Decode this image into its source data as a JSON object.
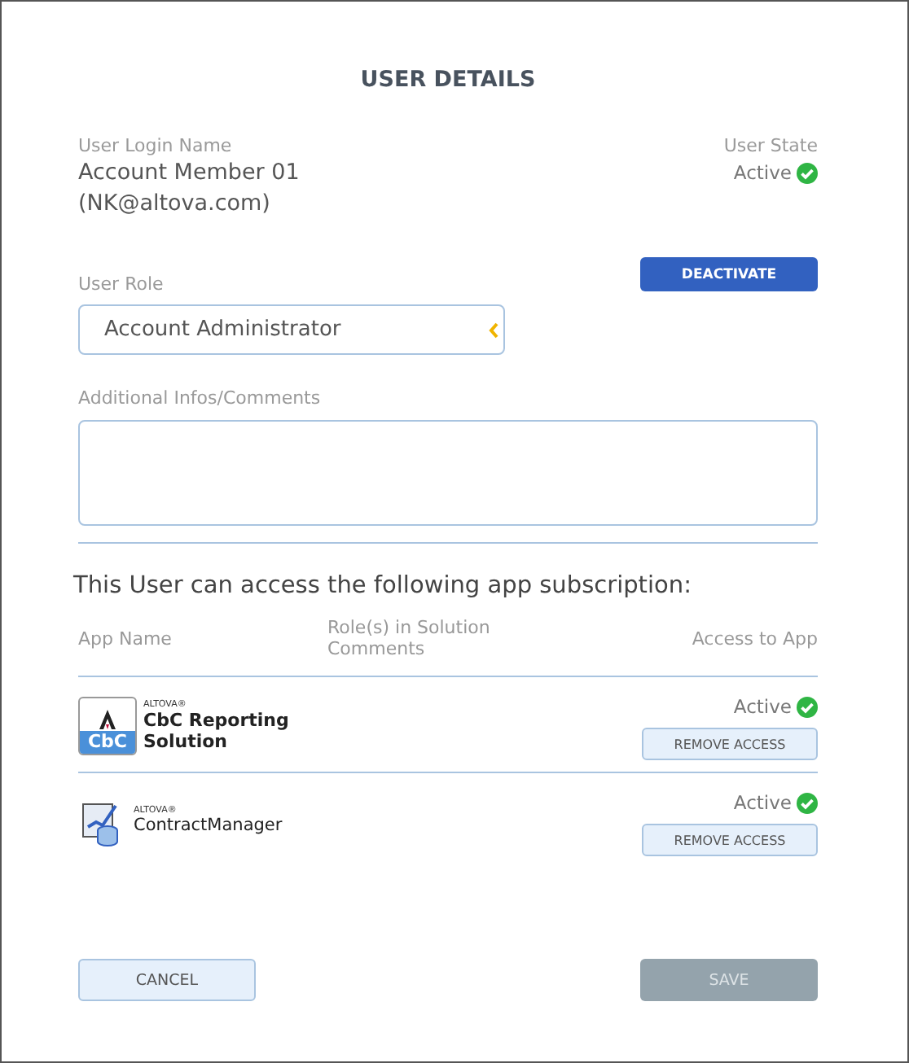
{
  "title": "USER DETAILS",
  "login": {
    "label": "User Login Name",
    "name": "Account Member 01",
    "email": "(NK@altova.com)"
  },
  "state": {
    "label": "User State",
    "value": "Active"
  },
  "deactivate_button": {
    "label": "DEACTIVATE"
  },
  "role": {
    "label": "User Role",
    "value": "Account Administrator"
  },
  "comments": {
    "label": "Additional Infos/Comments"
  },
  "subscription_heading": "This User can access the following app subscription:",
  "table": {
    "columns": [
      "App Name",
      "Role(s) in Solution Comments",
      "Access to App"
    ],
    "rows": [
      {
        "kind": "cbc",
        "brand": "ALTOVA®",
        "badge": "CbC",
        "name": "CbC Reporting Solution",
        "status": "Active",
        "button": "REMOVE ACCESS"
      },
      {
        "kind": "contract",
        "brand": "ALTOVA®",
        "name": "ContractManager",
        "status": "Active",
        "button": "REMOVE ACCESS"
      }
    ]
  },
  "buttons": [
    {
      "label": "CANCEL",
      "kind": "secondary",
      "disabled": false
    },
    {
      "label": "SAVE",
      "kind": "primary",
      "disabled": true
    }
  ]
}
